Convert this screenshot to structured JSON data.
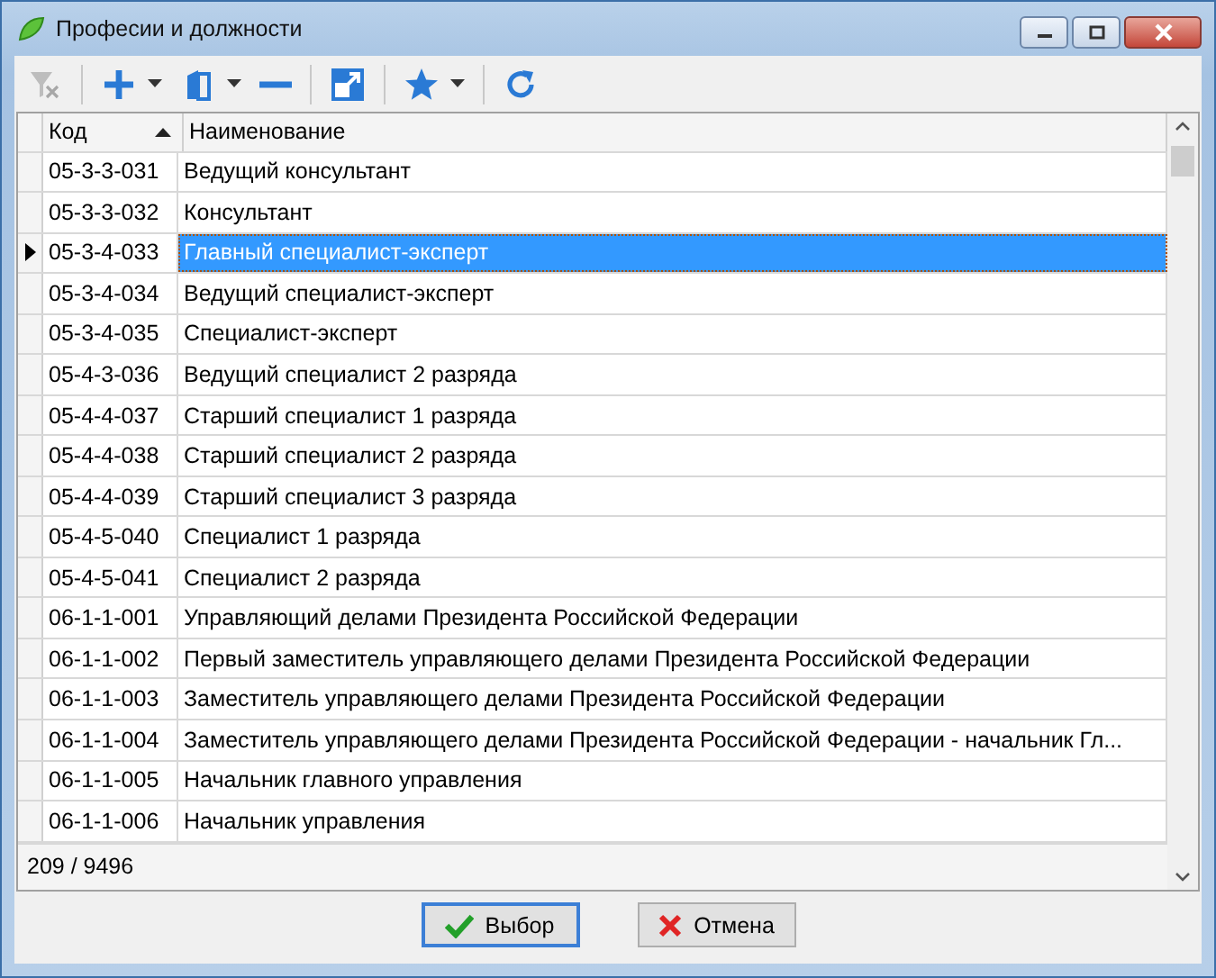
{
  "window": {
    "title": "Професии и должности"
  },
  "toolbar": [
    {
      "kind": "filter-clear",
      "disabled": true,
      "dropdown": false
    },
    {
      "kind": "add",
      "disabled": false,
      "dropdown": true
    },
    {
      "kind": "copy",
      "disabled": false,
      "dropdown": true
    },
    {
      "kind": "remove",
      "disabled": false,
      "dropdown": false
    },
    {
      "kind": "open",
      "disabled": false,
      "dropdown": false
    },
    {
      "kind": "favorite",
      "disabled": false,
      "dropdown": true
    },
    {
      "kind": "refresh",
      "disabled": false,
      "dropdown": false
    }
  ],
  "table": {
    "columns": [
      {
        "label": "Код",
        "sorted": true
      },
      {
        "label": "Наименование",
        "sorted": false
      }
    ],
    "rows": [
      {
        "code": "05-3-3-031",
        "name": "Ведущий консультант",
        "selected": false
      },
      {
        "code": "05-3-3-032",
        "name": "Консультант",
        "selected": false
      },
      {
        "code": "05-3-4-033",
        "name": "Главный специалист-эксперт",
        "selected": true
      },
      {
        "code": "05-3-4-034",
        "name": "Ведущий специалист-эксперт",
        "selected": false
      },
      {
        "code": "05-3-4-035",
        "name": "Специалист-эксперт",
        "selected": false
      },
      {
        "code": "05-4-3-036",
        "name": "Ведущий специалист 2 разряда",
        "selected": false
      },
      {
        "code": "05-4-4-037",
        "name": "Старший специалист 1 разряда",
        "selected": false
      },
      {
        "code": "05-4-4-038",
        "name": "Старший специалист 2 разряда",
        "selected": false
      },
      {
        "code": "05-4-4-039",
        "name": "Старший специалист 3 разряда",
        "selected": false
      },
      {
        "code": "05-4-5-040",
        "name": "Специалист 1 разряда",
        "selected": false
      },
      {
        "code": "05-4-5-041",
        "name": "Специалист 2 разряда",
        "selected": false
      },
      {
        "code": "06-1-1-001",
        "name": "Управляющий делами Президента Российской Федерации",
        "selected": false
      },
      {
        "code": "06-1-1-002",
        "name": "Первый заместитель управляющего делами Президента Российской Федерации",
        "selected": false
      },
      {
        "code": "06-1-1-003",
        "name": "Заместитель управляющего делами Президента Российской Федерации",
        "selected": false
      },
      {
        "code": "06-1-1-004",
        "name": "Заместитель управляющего делами Президента Российской Федерации - начальник Гл...",
        "selected": false
      },
      {
        "code": "06-1-1-005",
        "name": "Начальник главного управления",
        "selected": false
      },
      {
        "code": "06-1-1-006",
        "name": "Начальник управления",
        "selected": false
      }
    ],
    "footer": "209 / 9496"
  },
  "buttons": [
    {
      "kind": "ok",
      "label": "Выбор",
      "default": true
    },
    {
      "kind": "cancel",
      "label": "Отмена",
      "default": false
    }
  ]
}
